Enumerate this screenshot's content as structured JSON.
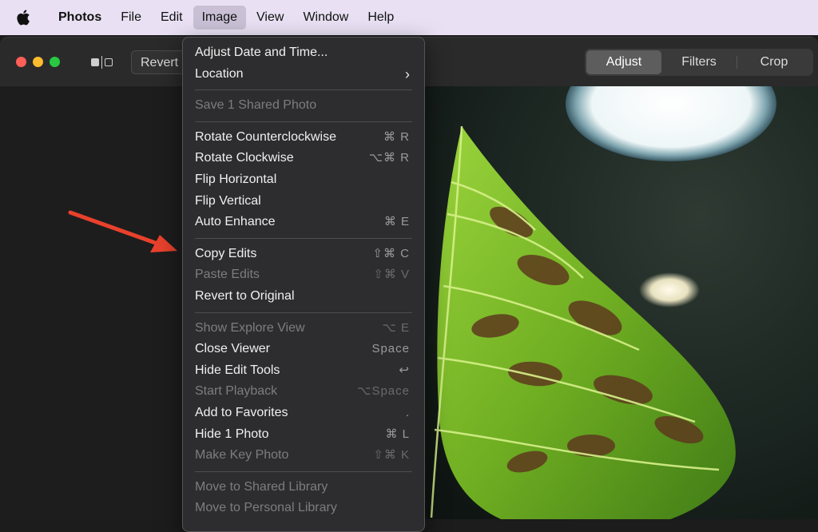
{
  "menubar": {
    "app_name": "Photos",
    "items": [
      "File",
      "Edit",
      "Image",
      "View",
      "Window",
      "Help"
    ],
    "active_item": "Image"
  },
  "toolbar": {
    "revert_label": "Revert",
    "tabs": [
      "Adjust",
      "Filters",
      "Crop"
    ],
    "selected_tab": "Adjust"
  },
  "image_menu": {
    "groups": [
      [
        {
          "label": "Adjust Date and Time...",
          "shortcut": "",
          "enabled": true
        },
        {
          "label": "Location",
          "shortcut": "",
          "enabled": true,
          "submenu": true
        }
      ],
      [
        {
          "label": "Save 1 Shared Photo",
          "shortcut": "",
          "enabled": false
        }
      ],
      [
        {
          "label": "Rotate Counterclockwise",
          "shortcut": "⌘ R",
          "enabled": true
        },
        {
          "label": "Rotate Clockwise",
          "shortcut": "⌥⌘ R",
          "enabled": true
        },
        {
          "label": "Flip Horizontal",
          "shortcut": "",
          "enabled": true
        },
        {
          "label": "Flip Vertical",
          "shortcut": "",
          "enabled": true
        },
        {
          "label": "Auto Enhance",
          "shortcut": "⌘ E",
          "enabled": true
        }
      ],
      [
        {
          "label": "Copy Edits",
          "shortcut": "⇧⌘ C",
          "enabled": true
        },
        {
          "label": "Paste Edits",
          "shortcut": "⇧⌘ V",
          "enabled": false
        },
        {
          "label": "Revert to Original",
          "shortcut": "",
          "enabled": true
        }
      ],
      [
        {
          "label": "Show Explore View",
          "shortcut": "⌥ E",
          "enabled": false
        },
        {
          "label": "Close Viewer",
          "shortcut": "Space",
          "enabled": true
        },
        {
          "label": "Hide Edit Tools",
          "shortcut": "↩",
          "enabled": true
        },
        {
          "label": "Start Playback",
          "shortcut": "⌥Space",
          "enabled": false
        },
        {
          "label": "Add to Favorites",
          "shortcut": ".",
          "enabled": true
        },
        {
          "label": "Hide 1 Photo",
          "shortcut": "⌘ L",
          "enabled": true
        },
        {
          "label": "Make Key Photo",
          "shortcut": "⇧⌘ K",
          "enabled": false
        }
      ],
      [
        {
          "label": "Move to Shared Library",
          "shortcut": "",
          "enabled": false
        },
        {
          "label": "Move to Personal Library",
          "shortcut": "",
          "enabled": false
        }
      ]
    ]
  },
  "annotation": {
    "arrow_color": "#e8412c",
    "points_to": "Copy Edits"
  },
  "colors": {
    "menubar_bg": "#e9e1f3",
    "menu_bg": "#2d2d2f",
    "toolbar_bg": "#2a2a2a"
  }
}
